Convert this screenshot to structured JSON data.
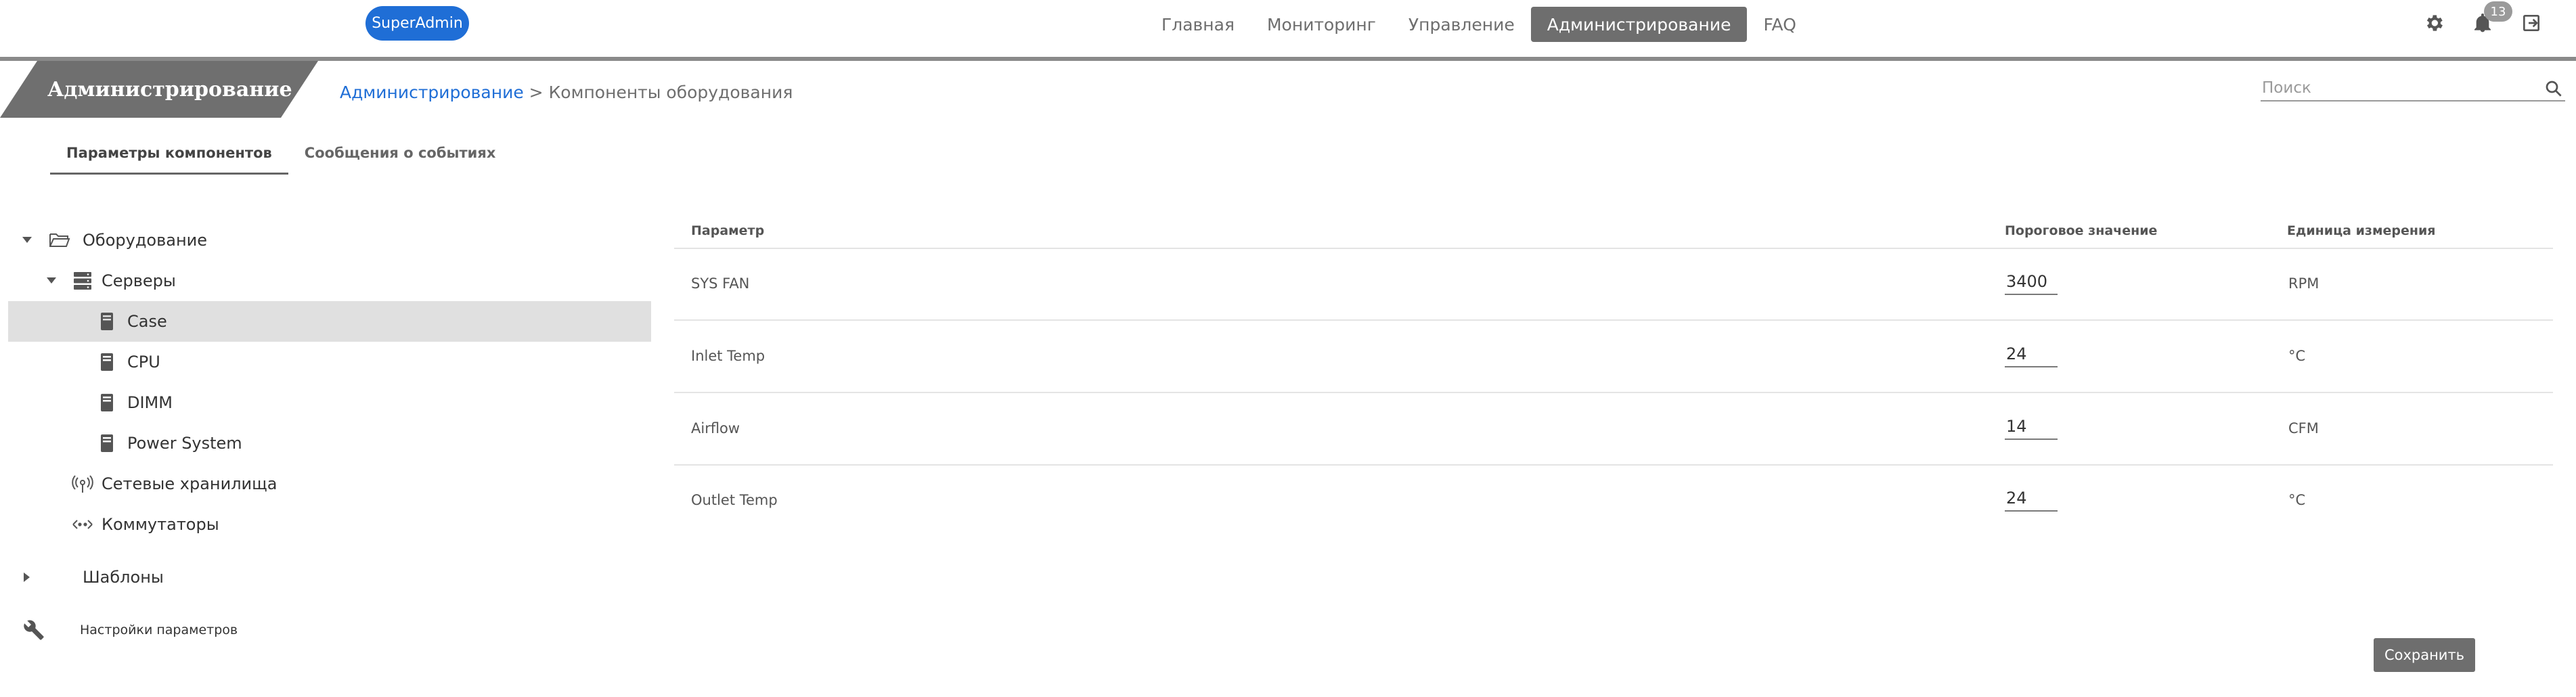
{
  "header": {
    "role_chip": "SuperAdmin",
    "nav": {
      "home": "Главная",
      "monitoring": "Мониторинг",
      "management": "Управление",
      "administration": "Администрирование",
      "faq": "FAQ"
    },
    "notifications_count": "13"
  },
  "section": {
    "title": "Администрирование",
    "breadcrumb_link": "Администрирование",
    "breadcrumb_separator": " > ",
    "breadcrumb_current": "Компоненты оборудования",
    "search_placeholder": "Поиск"
  },
  "subtabs": {
    "params": "Параметры компонентов",
    "events": "Сообщения о событиях"
  },
  "tree": {
    "equipment": "Оборудование",
    "servers": "Серверы",
    "case": "Case",
    "cpu": "CPU",
    "dimm": "DIMM",
    "power_system": "Power System",
    "storage": "Сетевые хранилища",
    "switches": "Коммутаторы",
    "templates": "Шаблоны",
    "param_settings": "Настройки параметров"
  },
  "table": {
    "headers": {
      "param": "Параметр",
      "threshold": "Пороговое значение",
      "unit": "Единица измерения"
    },
    "rows": [
      {
        "param": "SYS FAN",
        "threshold": "3400",
        "unit": "RPM"
      },
      {
        "param": "Inlet Temp",
        "threshold": "24",
        "unit": "°C"
      },
      {
        "param": "Airflow",
        "threshold": "14",
        "unit": "CFM"
      },
      {
        "param": "Outlet Temp",
        "threshold": "24",
        "unit": "°C"
      }
    ]
  },
  "actions": {
    "save": "Сохранить"
  },
  "icons": {
    "settings": "gear-icon",
    "notifications": "bell-icon",
    "logout": "logout-icon",
    "search": "search-icon"
  },
  "colors": {
    "accent": "#1f6ed6",
    "active_nav": "#6e6e6e",
    "selected_row": "#e0e0e0"
  }
}
